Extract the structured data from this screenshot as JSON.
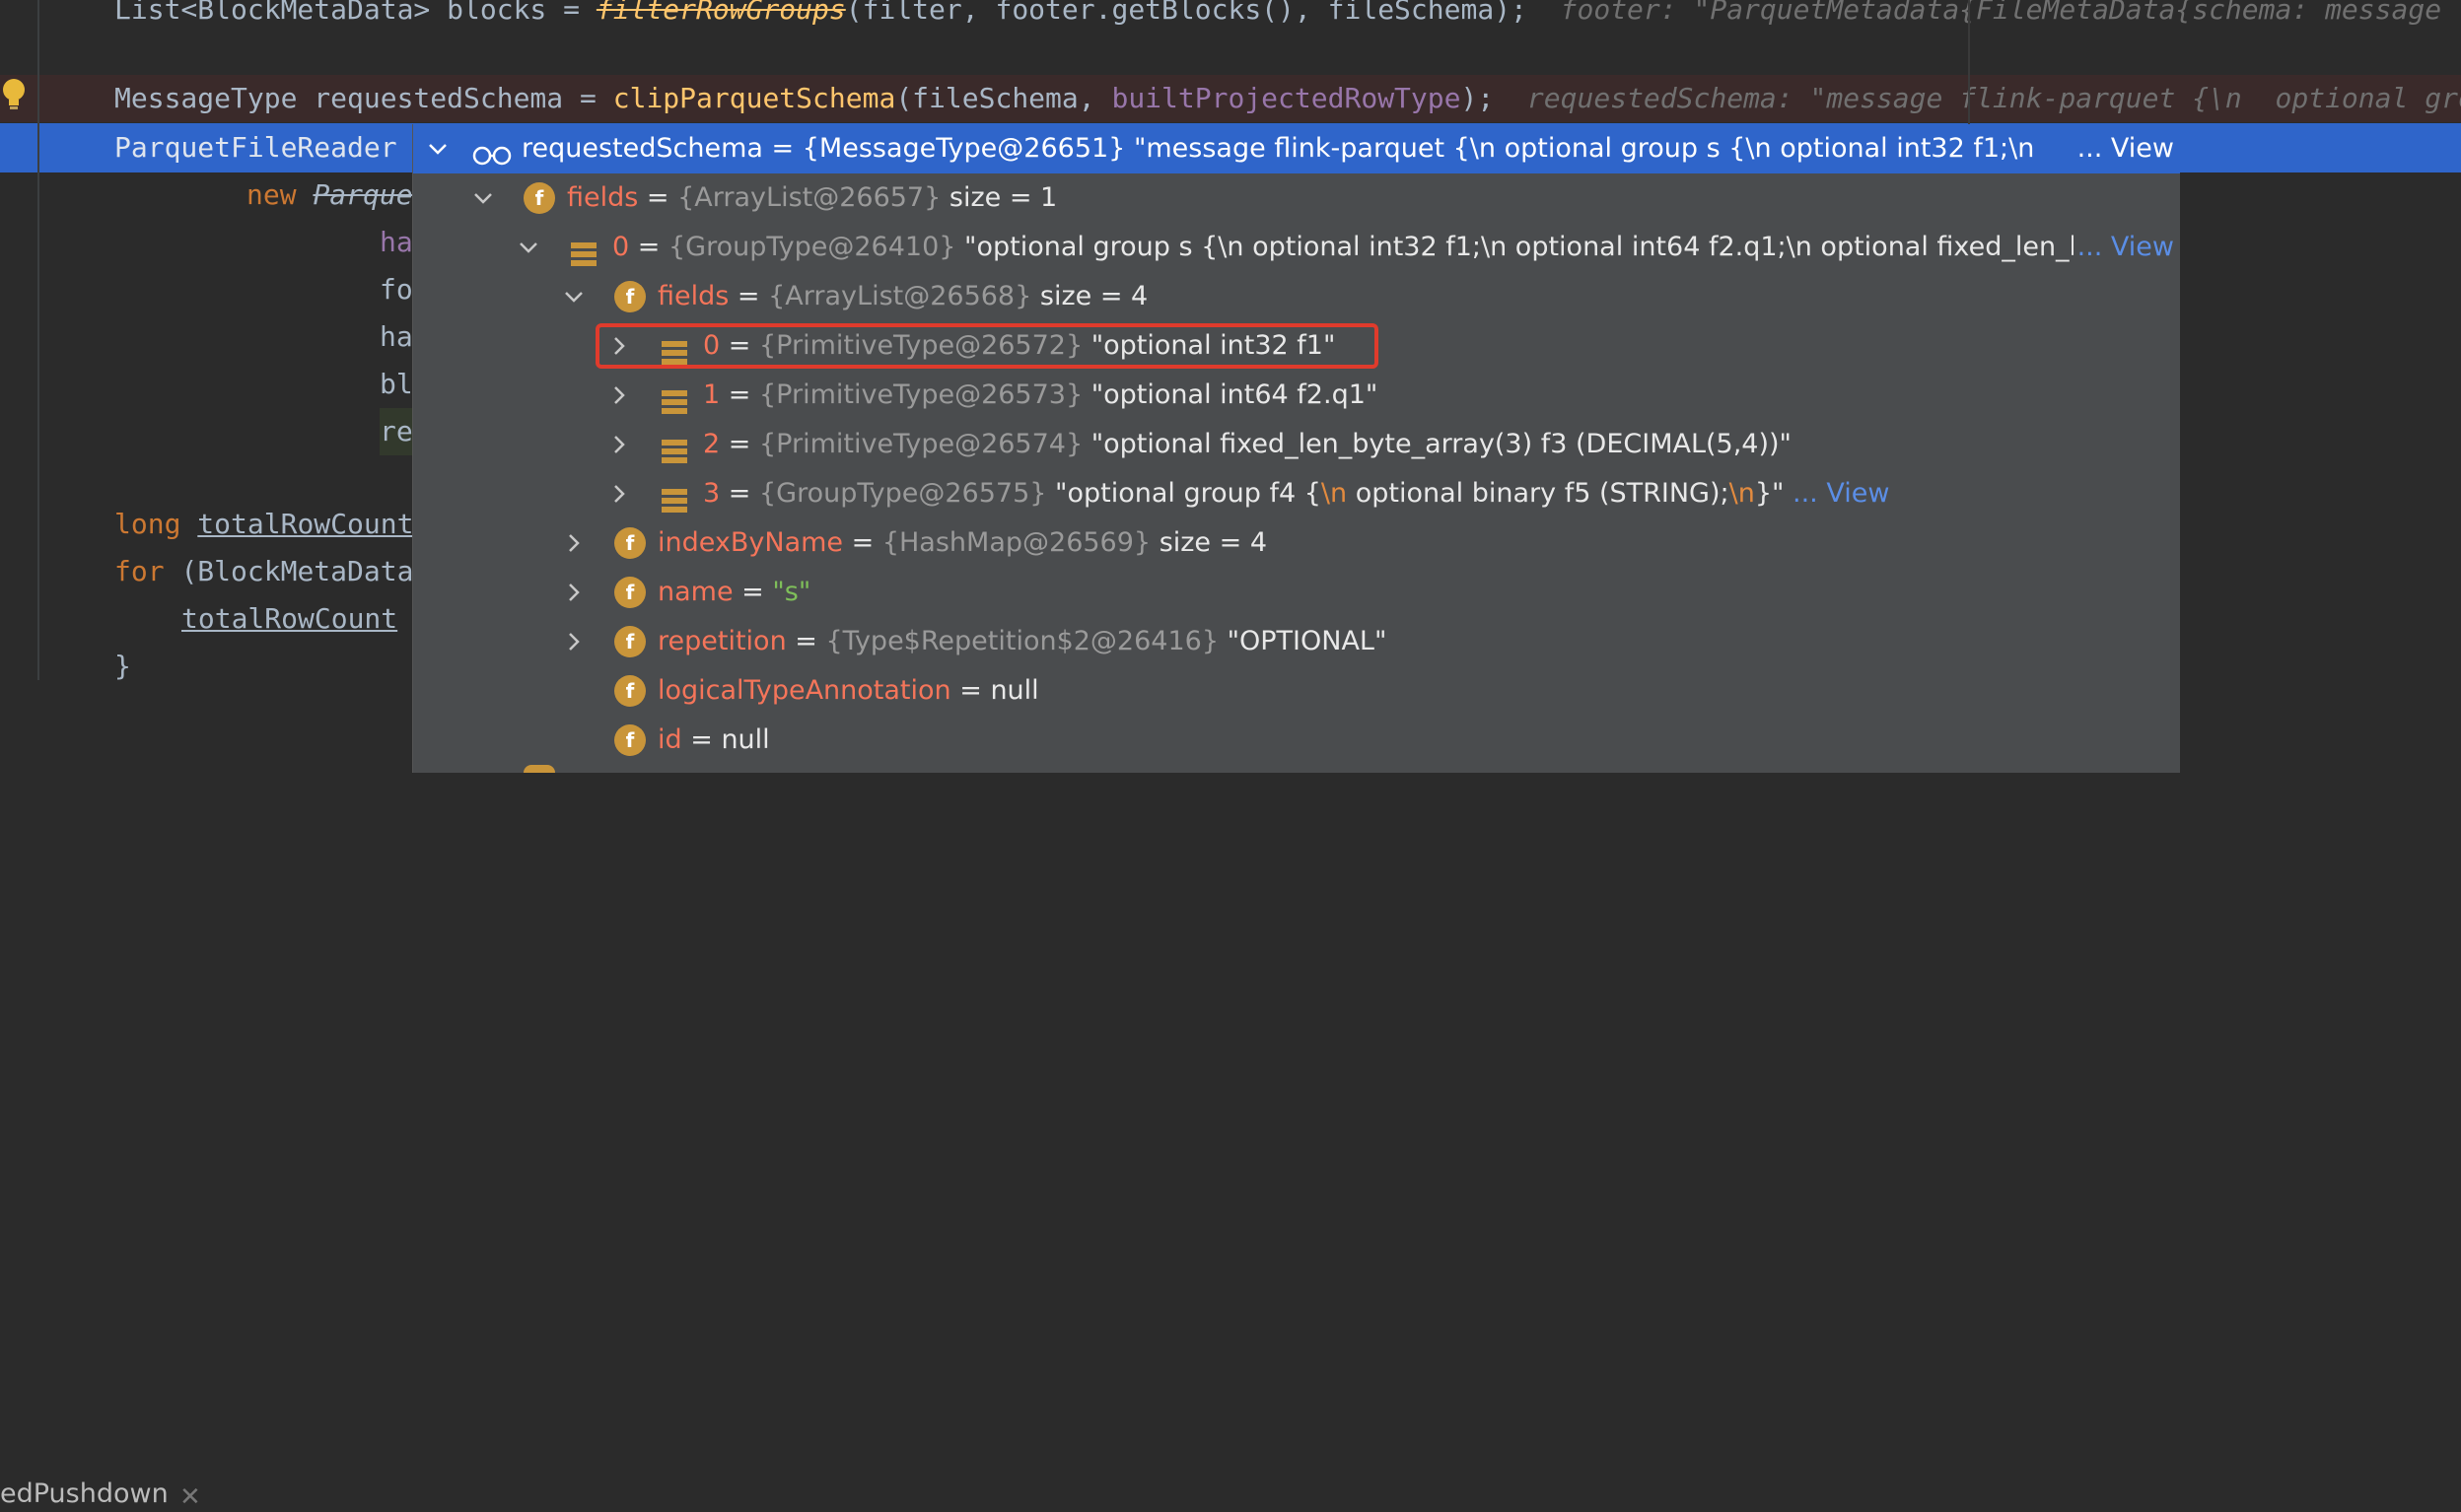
{
  "editor": {
    "lines": [
      {
        "id": "line-blocks",
        "text_a": "List<BlockMetaData> blocks = ",
        "text_b": "filterRowGroups",
        "text_c": "(filter, footer.getBlocks(), fileSchema);",
        "hint": "footer: \"ParquetMetadata{FileMetaData{schema: message fl"
      },
      {
        "id": "line-requested",
        "text_a": "MessageType requestedSchema = ",
        "text_b": "clipParquetSchema",
        "text_c": "(fileSchema, ",
        "text_d": "builtProjectedRowType",
        "text_e": ");",
        "hint": "requestedSchema: \"message flink-parquet {\\n  optional gro"
      },
      {
        "id": "line-reader",
        "text": "ParquetFileReader"
      },
      {
        "id": "line-new",
        "kw": "new ",
        "text": "Parque"
      },
      {
        "id": "line-ha1",
        "text": "ha"
      },
      {
        "id": "line-fo",
        "text": "fo"
      },
      {
        "id": "line-ha2",
        "text": "ha"
      },
      {
        "id": "line-bl",
        "text": "bl"
      },
      {
        "id": "line-re",
        "text": "re"
      },
      {
        "id": "line-long",
        "kw": "long ",
        "text": "totalRowCount"
      },
      {
        "id": "line-for",
        "kw": "for ",
        "text": "(BlockMetaData"
      },
      {
        "id": "line-total",
        "text": "totalRowCount"
      },
      {
        "id": "line-brace",
        "text": "}"
      }
    ]
  },
  "tab": {
    "label": "edPushdown",
    "close": "✕"
  },
  "popup": {
    "header": {
      "var": "requestedSchema",
      "eq": " = ",
      "type": "{MessageType@26651}",
      "value": " \"message flink-parquet {\\n  optional group s {\\n    optional int32 f1;\\n  ",
      "ellipsis": "... View"
    },
    "rows": [
      {
        "name": "fields",
        "type": "{ArrayList@26657}",
        "extra": "size = 1"
      },
      {
        "name": "0",
        "type": "{GroupType@26410}",
        "value": "\"optional group s {\\n  optional int32 f1;\\n  optional int64 f2.q1;\\n  optional fixed_len_l",
        "link": "... View"
      },
      {
        "name": "fields",
        "type": "{ArrayList@26568}",
        "extra": "size = 4"
      },
      {
        "name": "0",
        "type": "{PrimitiveType@26572}",
        "value": "\"optional int32 f1\""
      },
      {
        "name": "1",
        "type": "{PrimitiveType@26573}",
        "value": "\"optional int64 f2.q1\""
      },
      {
        "name": "2",
        "type": "{PrimitiveType@26574}",
        "value": "\"optional fixed_len_byte_array(3) f3 (DECIMAL(5,4))\""
      },
      {
        "name": "3",
        "type": "{GroupType@26575}",
        "value_a": "\"optional group f4 {",
        "esc1": "\\n",
        "value_b": "  optional binary f5 (STRING);",
        "esc2": "\\n",
        "value_c": "}\"",
        "link": "... View"
      },
      {
        "name": "indexByName",
        "type": "{HashMap@26569}",
        "extra": "size = 4"
      },
      {
        "name": "name",
        "value": "\"s\""
      },
      {
        "name": "repetition",
        "type": "{Type$Repetition$2@26416}",
        "value": "\"OPTIONAL\""
      },
      {
        "name": "logicalTypeAnnotation",
        "value": "null"
      },
      {
        "name": "id",
        "value": "null"
      }
    ],
    "eq": " = "
  },
  "colors": {
    "selection": "#2f65ca",
    "highlight_box": "#e03b2c",
    "field_icon": "#c9953a"
  },
  "icons": {
    "expand": "chevron-right-icon",
    "collapse": "chevron-down-icon",
    "field": "field-f-icon",
    "array_element": "stack-icon",
    "watch": "glasses-icon",
    "bulb": "lightbulb-icon"
  }
}
